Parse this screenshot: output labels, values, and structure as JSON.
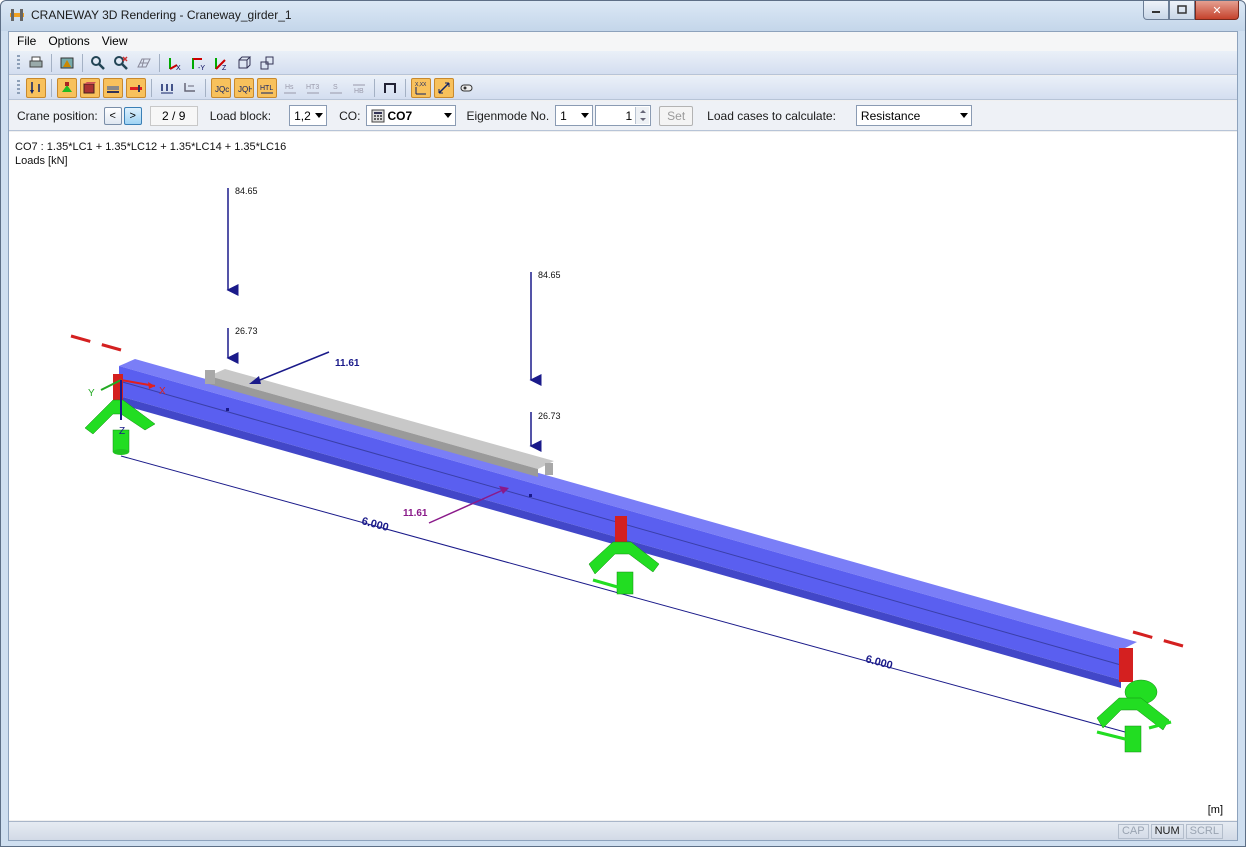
{
  "window": {
    "title": "CRANEWAY 3D Rendering - Craneway_girder_1",
    "min_icon": "minimize-icon",
    "max_icon": "maximize-icon",
    "close_label": "✕"
  },
  "menu": {
    "items": [
      "File",
      "Options",
      "View"
    ]
  },
  "controls": {
    "crane_position_label": "Crane position:",
    "prev_label": "<",
    "next_label": ">",
    "position_value": "2 / 9",
    "load_block_label": "Load block:",
    "load_block_value": "1,2",
    "co_label": "CO:",
    "co_value": "CO7",
    "eigenmode_label": "Eigenmode No.",
    "eigenmode_value": "1",
    "eigenmode_spin_value": "1",
    "set_label": "Set",
    "load_cases_label": "Load cases to calculate:",
    "load_cases_value": "Resistance"
  },
  "view": {
    "combination_text": "CO7 : 1.35*LC1 + 1.35*LC12 + 1.35*LC14 + 1.35*LC16",
    "loads_unit_text": "Loads [kN]",
    "unit_label": "[m]",
    "load_labels": {
      "vertical_1": "84.65",
      "vertical_1b": "26.73",
      "horizontal_1": "11.61",
      "vertical_2": "84.65",
      "vertical_2b": "26.73",
      "horizontal_2": "11.61"
    },
    "span_1": "6.000",
    "span_2": "6.000",
    "axes": {
      "x": "X",
      "y": "Y",
      "z": "Z"
    },
    "colors": {
      "girder": "#5a5ff0",
      "rail": "#b8b8b8",
      "support": "#22dd22",
      "stiffener": "#d42020",
      "load_arrow": "#1a1a8a",
      "horizontal_arrow_2": "#8a1a8a"
    }
  },
  "status": {
    "cap": "CAP",
    "num": "NUM",
    "scrl": "SCRL"
  }
}
